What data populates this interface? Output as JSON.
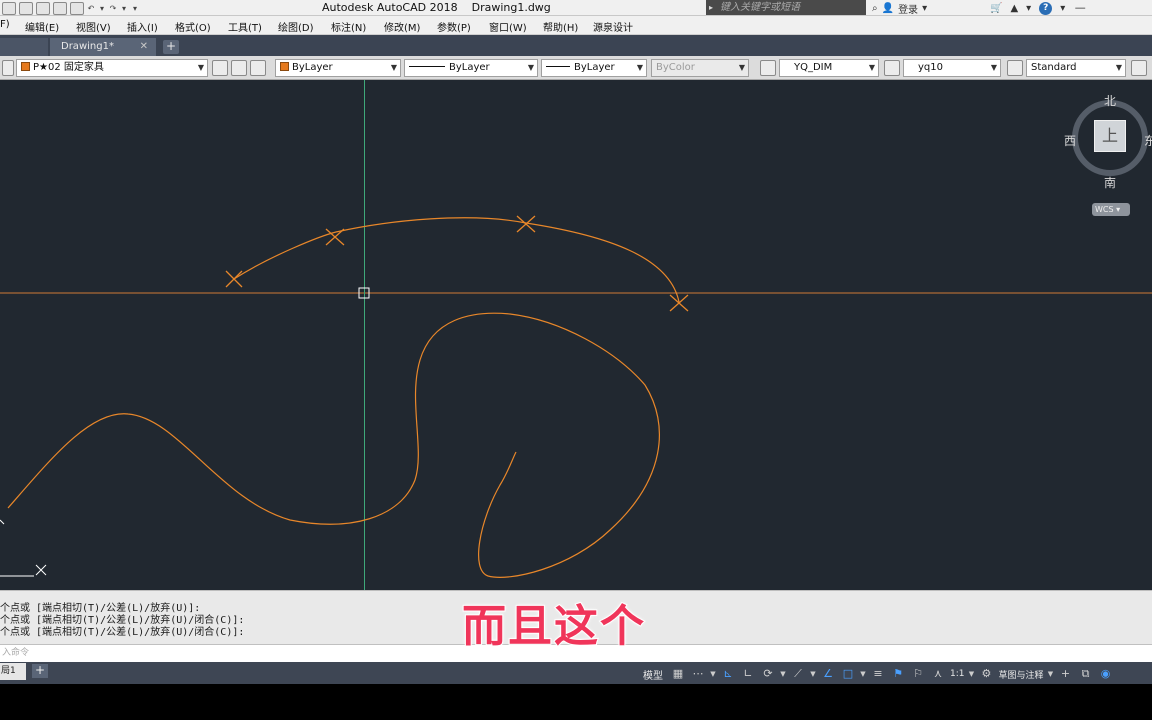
{
  "app": {
    "title": "Autodesk AutoCAD 2018",
    "document": "Drawing1.dwg",
    "search_placeholder": "键入关键字或短语",
    "login_label": "登录"
  },
  "menu": [
    {
      "label": "F)"
    },
    {
      "label": "编辑(E)"
    },
    {
      "label": "视图(V)"
    },
    {
      "label": "插入(I)"
    },
    {
      "label": "格式(O)"
    },
    {
      "label": "工具(T)"
    },
    {
      "label": "绘图(D)"
    },
    {
      "label": "标注(N)"
    },
    {
      "label": "修改(M)"
    },
    {
      "label": "参数(P)"
    },
    {
      "label": "窗口(W)"
    },
    {
      "label": "帮助(H)"
    },
    {
      "label": "源泉设计"
    }
  ],
  "tabs": {
    "active": "Drawing1*",
    "close_glyph": "✕",
    "add_glyph": "+"
  },
  "properties": {
    "layer": "P★02 固定家具",
    "color": "ByLayer",
    "linetype": "ByLayer",
    "lineweight": "ByLayer",
    "plotstyle": "ByColor",
    "dim_style": "YQ_DIM",
    "text_style": "yq10",
    "table_style": "Standard",
    "accent_color": "#e67a1e"
  },
  "viewcube": {
    "north": "北",
    "south": "南",
    "west": "西",
    "east": "东",
    "top_face": "上",
    "wcs": "WCS"
  },
  "command": {
    "history": [
      "个点或 [端点相切(T)/公差(L)/放弃(U)]:",
      "个点或 [端点相切(T)/公差(L)/放弃(U)/闭合(C)]:",
      "个点或 [端点相切(T)/公差(L)/放弃(U)/闭合(C)]:"
    ],
    "prompt_placeholder": "入命令"
  },
  "subtitle": "而且这个",
  "status": {
    "layout_tab": "局1",
    "add_glyph": "+",
    "model": "模型",
    "scale": "1:1",
    "annotation": "草图与注释"
  },
  "colors": {
    "canvas_bg": "#212830",
    "curve": "#e8872a",
    "crosshair_h": "#e8872a",
    "crosshair_v": "#3fa97a"
  }
}
